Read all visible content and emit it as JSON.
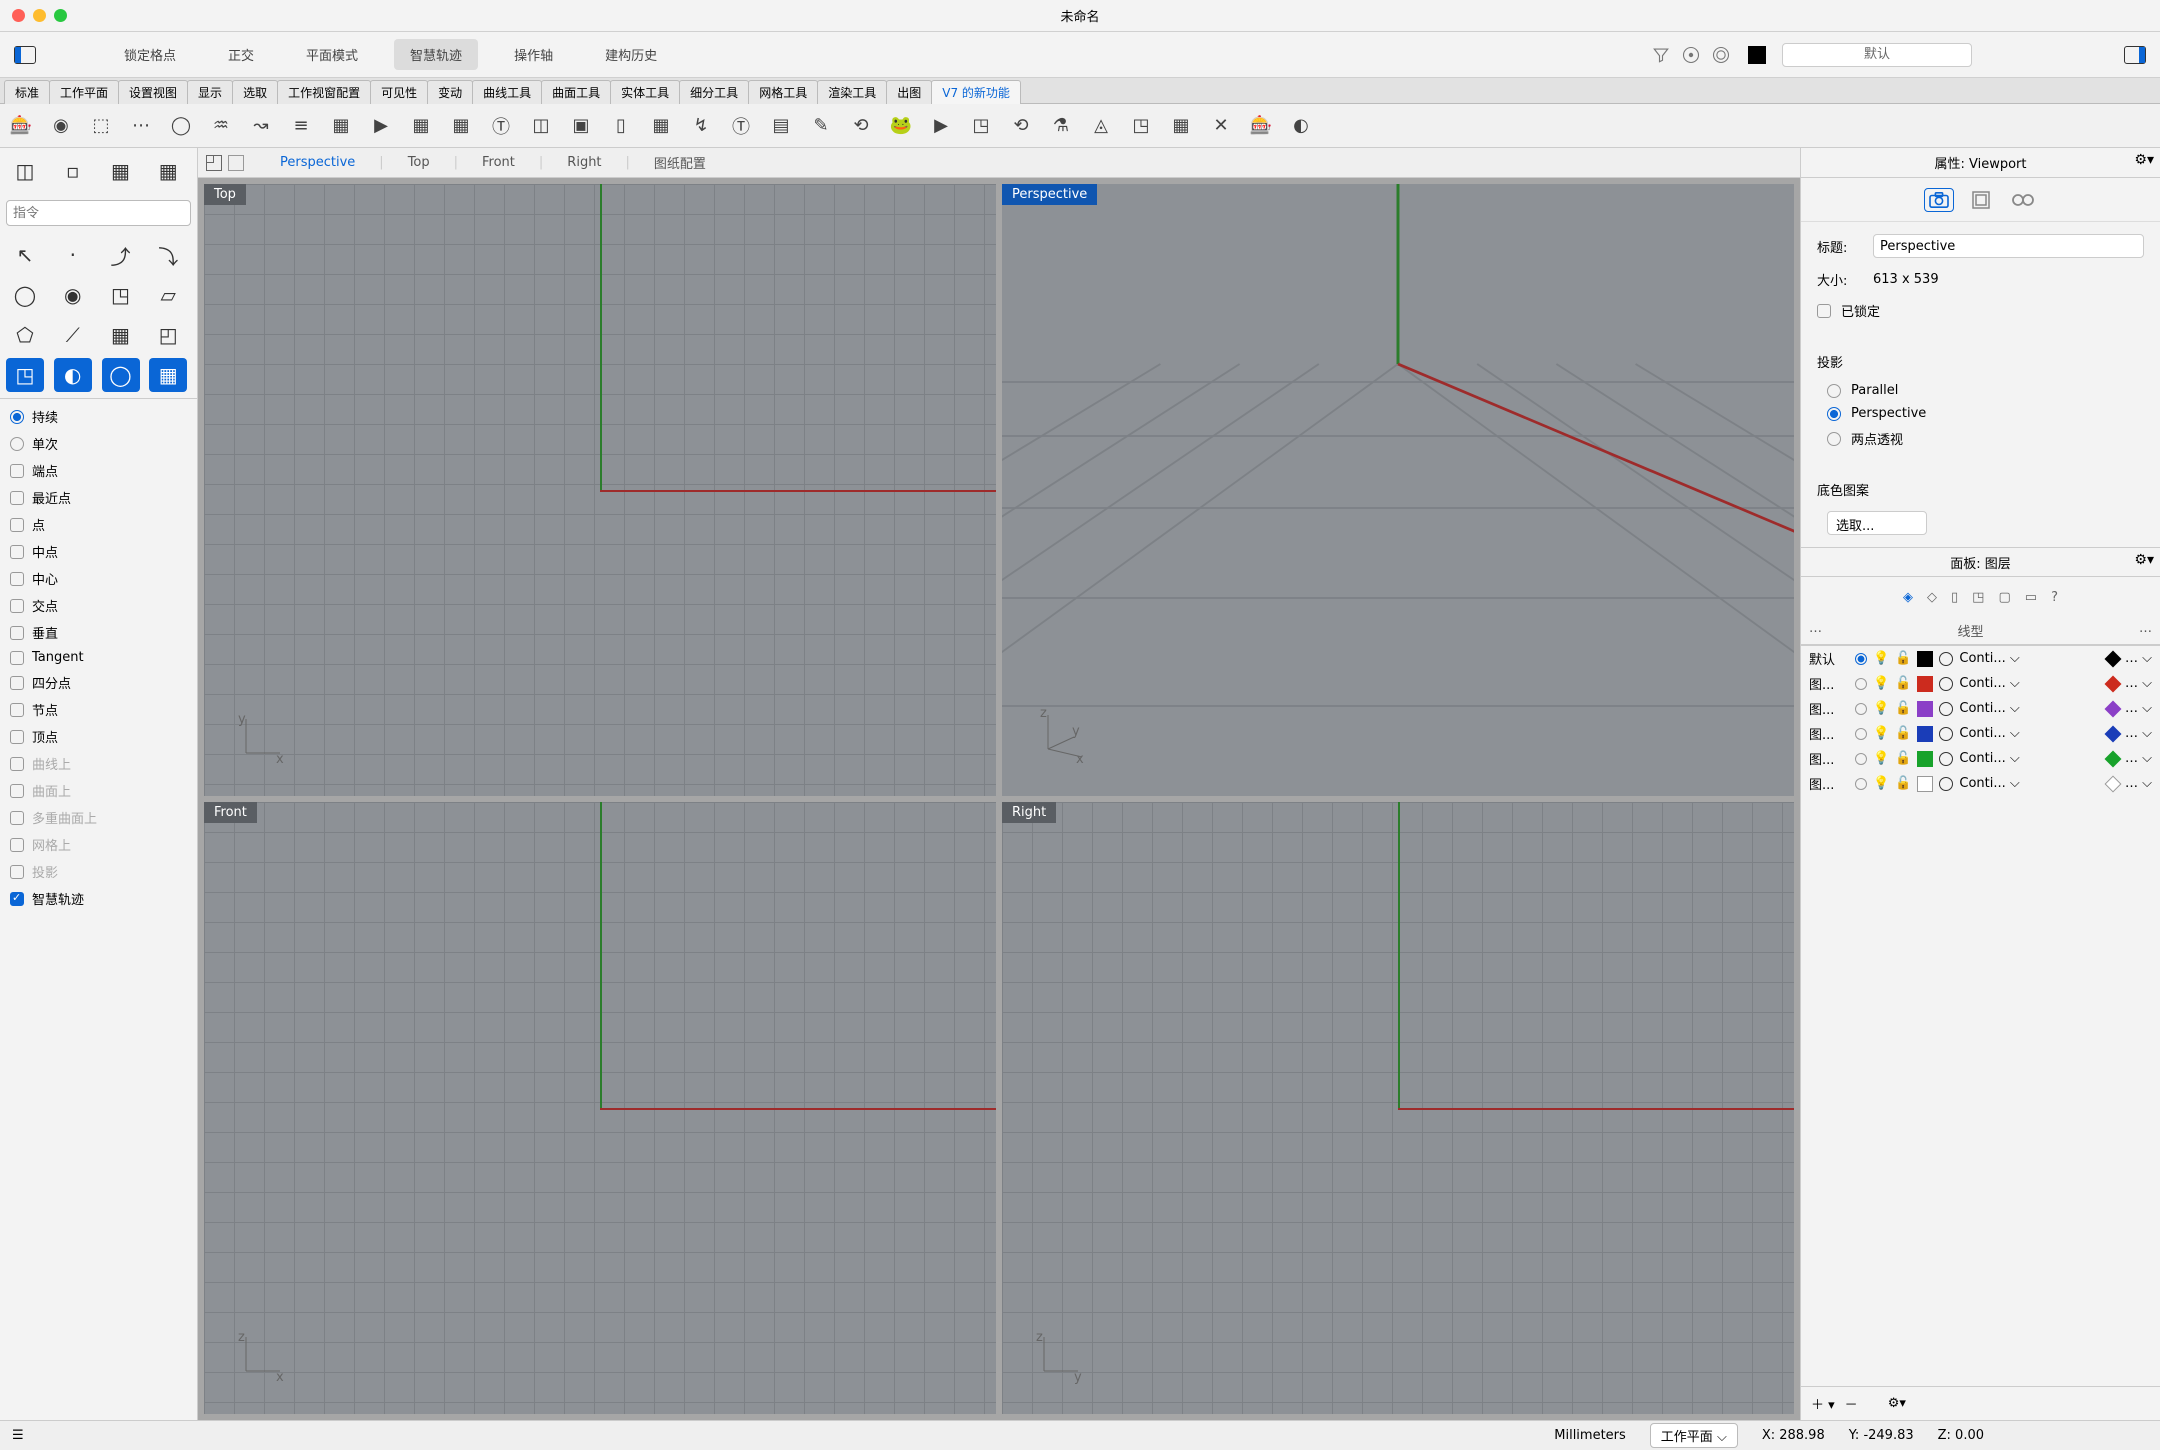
{
  "window": {
    "title": "未命名"
  },
  "menubar": {
    "items": [
      "锁定格点",
      "正交",
      "平面模式",
      "智慧轨迹",
      "操作轴",
      "建构历史"
    ],
    "active_index": 3,
    "layer_select": "默认"
  },
  "tabstrip": {
    "tabs": [
      "标准",
      "工作平面",
      "设置视图",
      "显示",
      "选取",
      "工作视窗配置",
      "可见性",
      "变动",
      "曲线工具",
      "曲面工具",
      "实体工具",
      "细分工具",
      "网格工具",
      "渲染工具",
      "出图",
      "V7 的新功能"
    ],
    "active_index": 15
  },
  "view_tabs": {
    "items": [
      "Perspective",
      "Top",
      "Front",
      "Right",
      "图纸配置"
    ],
    "active_index": 0
  },
  "viewports": {
    "top": "Top",
    "perspective": "Perspective",
    "front": "Front",
    "right": "Right",
    "active": "Perspective"
  },
  "command": {
    "placeholder": "指令"
  },
  "osnap": {
    "radios": [
      {
        "label": "持续",
        "on": true
      },
      {
        "label": "单次",
        "on": false
      }
    ],
    "checks": [
      {
        "label": "端点",
        "on": false
      },
      {
        "label": "最近点",
        "on": false
      },
      {
        "label": "点",
        "on": false
      },
      {
        "label": "中点",
        "on": false
      },
      {
        "label": "中心",
        "on": false
      },
      {
        "label": "交点",
        "on": false
      },
      {
        "label": "垂直",
        "on": false
      },
      {
        "label": "Tangent",
        "on": false
      },
      {
        "label": "四分点",
        "on": false
      },
      {
        "label": "节点",
        "on": false
      },
      {
        "label": "顶点",
        "on": false
      },
      {
        "label": "曲线上",
        "on": false,
        "dis": true
      },
      {
        "label": "曲面上",
        "on": false,
        "dis": true
      },
      {
        "label": "多重曲面上",
        "on": false,
        "dis": true
      },
      {
        "label": "网格上",
        "on": false,
        "dis": true
      },
      {
        "label": "投影",
        "on": false,
        "dis": true
      },
      {
        "label": "智慧轨迹",
        "on": true
      }
    ]
  },
  "properties": {
    "panel_title": "属性: Viewport",
    "title_label": "标题:",
    "title_value": "Perspective",
    "size_label": "大小:",
    "size_value": "613 x 539",
    "locked_label": "已锁定",
    "projection_label": "投影",
    "projection_options": [
      "Parallel",
      "Perspective",
      "两点透视"
    ],
    "projection_selected": 1,
    "bg_label": "底色图案",
    "bg_select": "选取..."
  },
  "layers": {
    "panel_title": "面板: 图层",
    "col_ellipsis": "…",
    "col_line": "线型",
    "rows": [
      {
        "name": "默认",
        "current": true,
        "color": "#000000",
        "line": "Conti...",
        "print": "#000000"
      },
      {
        "name": "图...",
        "current": false,
        "color": "#cc2b1e",
        "line": "Conti...",
        "print": "#cc2b1e"
      },
      {
        "name": "图...",
        "current": false,
        "color": "#8b3fc7",
        "line": "Conti...",
        "print": "#8b3fc7"
      },
      {
        "name": "图...",
        "current": false,
        "color": "#1a3db8",
        "line": "Conti...",
        "print": "#1a3db8"
      },
      {
        "name": "图...",
        "current": false,
        "color": "#18a22b",
        "line": "Conti...",
        "print": "#18a22b"
      },
      {
        "name": "图...",
        "current": false,
        "color": "#ffffff",
        "line": "Conti...",
        "print": "#ffffff"
      }
    ]
  },
  "status": {
    "units": "Millimeters",
    "cplane": "工作平面",
    "x": "X: 288.98",
    "y": "Y: -249.83",
    "z": "Z: 0.00"
  }
}
